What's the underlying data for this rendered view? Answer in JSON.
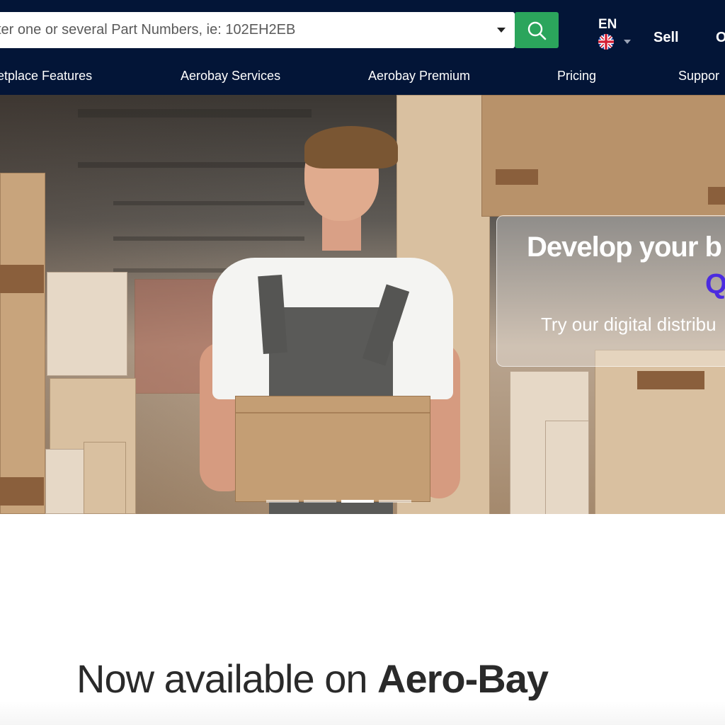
{
  "search": {
    "placeholder": "ter one or several Part Numbers, ie: 102EH2EB",
    "icon": "search-icon"
  },
  "header": {
    "language_code": "EN",
    "language_flag": "uk-flag-icon",
    "sell_label": "Sell",
    "cut_item_label": "O"
  },
  "nav": {
    "items": [
      {
        "label": "etplace Features"
      },
      {
        "label": "Aerobay Services"
      },
      {
        "label": "Aerobay Premium"
      },
      {
        "label": "Pricing"
      },
      {
        "label": "Suppor"
      }
    ]
  },
  "hero": {
    "promo_title": "Develop your b",
    "promo_highlight": "Q",
    "promo_subtitle": "Try our digital distribu",
    "slides_total": 4,
    "active_slide": 3
  },
  "section": {
    "headline_light": "Now available on ",
    "headline_strong": "Aero-Bay"
  },
  "colors": {
    "header_bg": "#031537",
    "search_button": "#2ba55c",
    "promo_highlight": "#4b2be0"
  }
}
